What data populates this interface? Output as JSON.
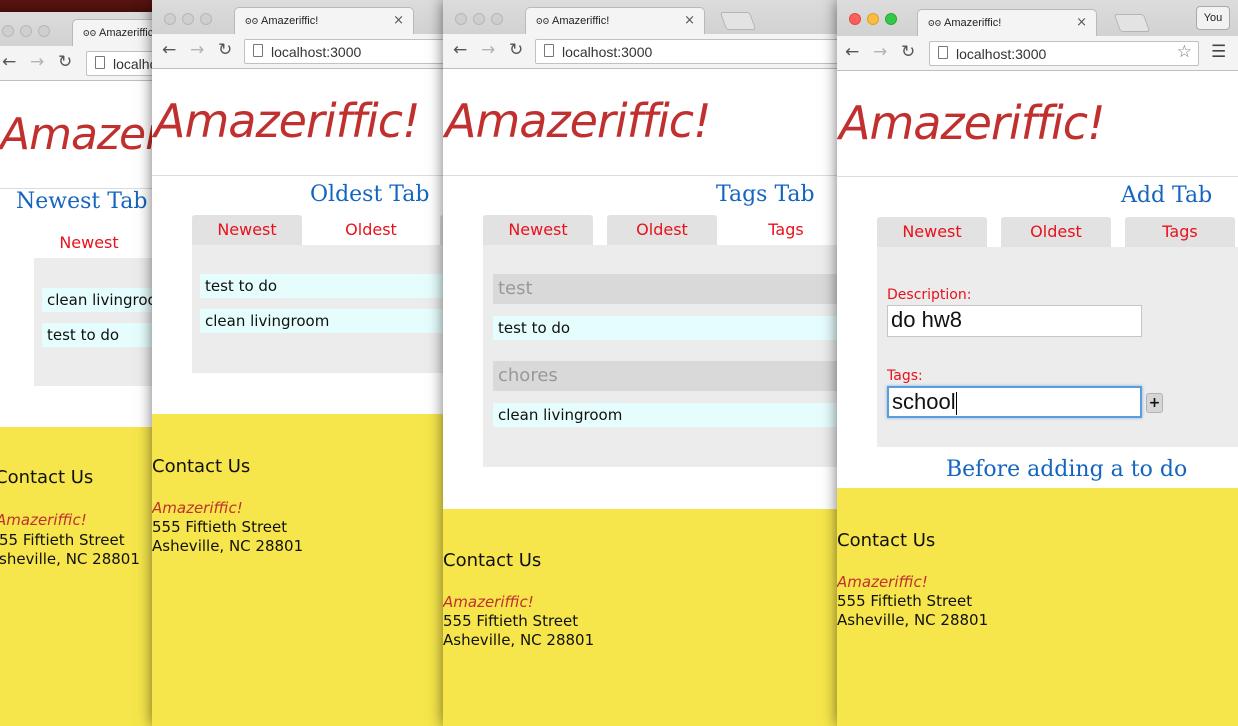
{
  "browser": {
    "tab_title": "Amazeriffic!",
    "tab_favicon": "ʘʘ",
    "tab_close": "×",
    "url": "localhost:3000",
    "url_clipped": "localhost",
    "user_button": "You",
    "icons": [
      "back-icon",
      "forward-icon",
      "reload-icon",
      "page-icon",
      "star-icon",
      "menu-icon",
      "close-icon"
    ]
  },
  "app": {
    "brand": "Amazeriffic!",
    "brand_clipped": "Amazeri",
    "tabs": [
      "Newest",
      "Oldest",
      "Tags"
    ],
    "colors": {
      "brand": "#c0302f",
      "tab_text": "#e8111c",
      "section_title": "#1565c0",
      "footer": "#f6e64b",
      "item_bg": "#e6fdfd"
    }
  },
  "win1": {
    "section_title": "Newest Tab",
    "items": [
      "clean livingroom",
      "test to do"
    ]
  },
  "win2": {
    "section_title": "Oldest Tab",
    "items": [
      "test to do",
      "clean livingroom"
    ]
  },
  "win3": {
    "section_title": "Tags Tab",
    "groups": [
      {
        "tag": "test",
        "items": [
          "test to do"
        ]
      },
      {
        "tag": "chores",
        "items": [
          "clean livingroom"
        ]
      }
    ]
  },
  "win4": {
    "section_title": "Add Tab",
    "description_label": "Description:",
    "description_value": "do hw8",
    "tags_label": "Tags:",
    "tags_value": "school",
    "add_button": "+",
    "caption": "Before adding a to do"
  },
  "footer": {
    "contact_title": "Contact Us",
    "brand": "Amazeriffic!",
    "address_line1": "555 Fiftieth Street",
    "address_line1_clipped": "55 Fiftieth Street",
    "address_line2": "Asheville, NC 28801",
    "address_line2_clipped": "sheville, NC 28801"
  }
}
